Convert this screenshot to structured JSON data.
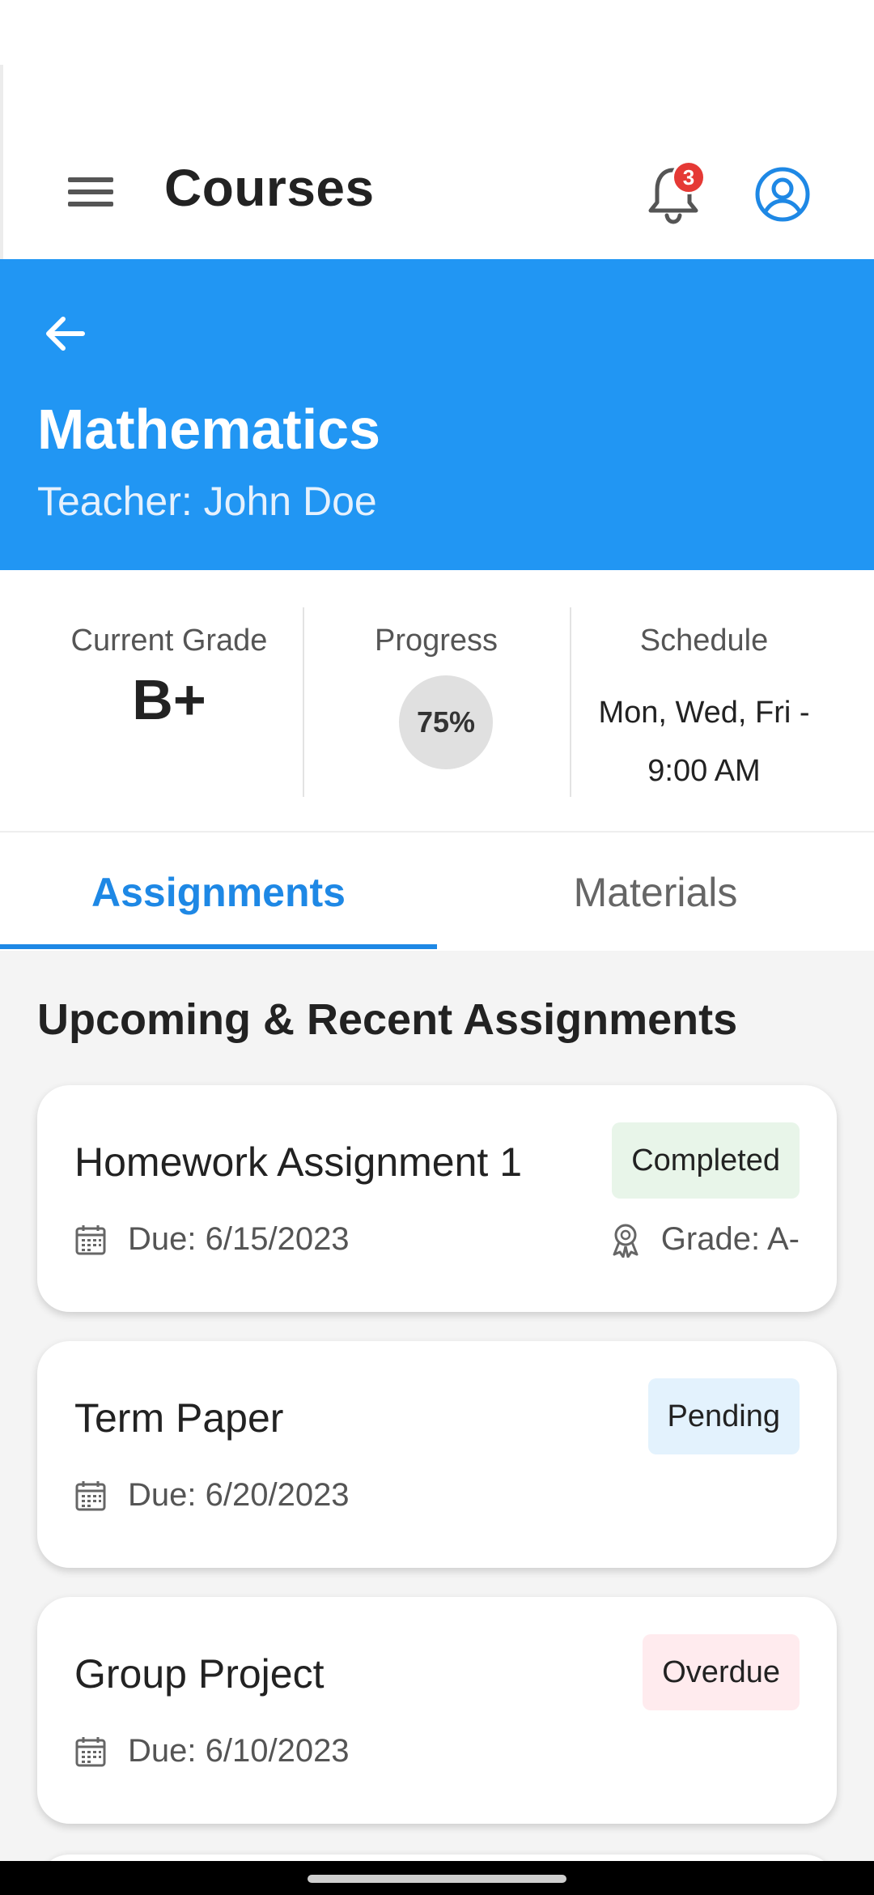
{
  "app_bar": {
    "title": "Courses",
    "notification_count": "3",
    "icons": {
      "menu": "hamburger-menu-icon",
      "bell": "bell-icon",
      "avatar": "user-circle-icon"
    }
  },
  "course": {
    "title": "Mathematics",
    "teacher": "Teacher: John Doe"
  },
  "stats": {
    "grade_label": "Current Grade",
    "grade_value": "B+",
    "progress_label": "Progress",
    "progress_value": "75%",
    "schedule_label": "Schedule",
    "schedule_line1": "Mon, Wed, Fri -",
    "schedule_line2": "9:00 AM"
  },
  "tabs": [
    {
      "label": "Assignments",
      "active": true
    },
    {
      "label": "Materials",
      "active": false
    }
  ],
  "section_title": "Upcoming & Recent Assignments",
  "assignments": [
    {
      "title": "Homework Assignment 1",
      "status": "Completed",
      "due": "Due: 6/15/2023",
      "grade": "Grade: A-"
    },
    {
      "title": "Term Paper",
      "status": "Pending",
      "due": "Due: 6/20/2023"
    },
    {
      "title": "Group Project",
      "status": "Overdue",
      "due": "Due: 6/10/2023"
    }
  ],
  "colors": {
    "primary": "#2196f3",
    "tab_active": "#1e88e5",
    "badge": "#e53935",
    "completed_bg": "#e8f5e9",
    "pending_bg": "#e3f2fd",
    "overdue_bg": "#ffebee"
  }
}
